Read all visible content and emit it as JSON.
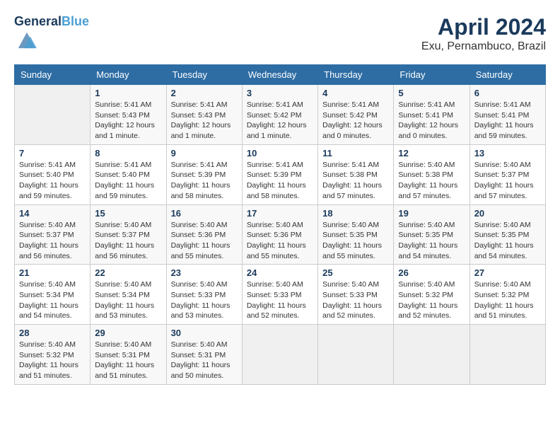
{
  "header": {
    "logo_line1": "General",
    "logo_line2": "Blue",
    "month_title": "April 2024",
    "location": "Exu, Pernambuco, Brazil"
  },
  "weekdays": [
    "Sunday",
    "Monday",
    "Tuesday",
    "Wednesday",
    "Thursday",
    "Friday",
    "Saturday"
  ],
  "weeks": [
    [
      {
        "day": "",
        "sunrise": "",
        "sunset": "",
        "daylight": ""
      },
      {
        "day": "1",
        "sunrise": "Sunrise: 5:41 AM",
        "sunset": "Sunset: 5:43 PM",
        "daylight": "Daylight: 12 hours and 1 minute."
      },
      {
        "day": "2",
        "sunrise": "Sunrise: 5:41 AM",
        "sunset": "Sunset: 5:43 PM",
        "daylight": "Daylight: 12 hours and 1 minute."
      },
      {
        "day": "3",
        "sunrise": "Sunrise: 5:41 AM",
        "sunset": "Sunset: 5:42 PM",
        "daylight": "Daylight: 12 hours and 1 minute."
      },
      {
        "day": "4",
        "sunrise": "Sunrise: 5:41 AM",
        "sunset": "Sunset: 5:42 PM",
        "daylight": "Daylight: 12 hours and 0 minutes."
      },
      {
        "day": "5",
        "sunrise": "Sunrise: 5:41 AM",
        "sunset": "Sunset: 5:41 PM",
        "daylight": "Daylight: 12 hours and 0 minutes."
      },
      {
        "day": "6",
        "sunrise": "Sunrise: 5:41 AM",
        "sunset": "Sunset: 5:41 PM",
        "daylight": "Daylight: 11 hours and 59 minutes."
      }
    ],
    [
      {
        "day": "7",
        "sunrise": "Sunrise: 5:41 AM",
        "sunset": "Sunset: 5:40 PM",
        "daylight": "Daylight: 11 hours and 59 minutes."
      },
      {
        "day": "8",
        "sunrise": "Sunrise: 5:41 AM",
        "sunset": "Sunset: 5:40 PM",
        "daylight": "Daylight: 11 hours and 59 minutes."
      },
      {
        "day": "9",
        "sunrise": "Sunrise: 5:41 AM",
        "sunset": "Sunset: 5:39 PM",
        "daylight": "Daylight: 11 hours and 58 minutes."
      },
      {
        "day": "10",
        "sunrise": "Sunrise: 5:41 AM",
        "sunset": "Sunset: 5:39 PM",
        "daylight": "Daylight: 11 hours and 58 minutes."
      },
      {
        "day": "11",
        "sunrise": "Sunrise: 5:41 AM",
        "sunset": "Sunset: 5:38 PM",
        "daylight": "Daylight: 11 hours and 57 minutes."
      },
      {
        "day": "12",
        "sunrise": "Sunrise: 5:40 AM",
        "sunset": "Sunset: 5:38 PM",
        "daylight": "Daylight: 11 hours and 57 minutes."
      },
      {
        "day": "13",
        "sunrise": "Sunrise: 5:40 AM",
        "sunset": "Sunset: 5:37 PM",
        "daylight": "Daylight: 11 hours and 57 minutes."
      }
    ],
    [
      {
        "day": "14",
        "sunrise": "Sunrise: 5:40 AM",
        "sunset": "Sunset: 5:37 PM",
        "daylight": "Daylight: 11 hours and 56 minutes."
      },
      {
        "day": "15",
        "sunrise": "Sunrise: 5:40 AM",
        "sunset": "Sunset: 5:37 PM",
        "daylight": "Daylight: 11 hours and 56 minutes."
      },
      {
        "day": "16",
        "sunrise": "Sunrise: 5:40 AM",
        "sunset": "Sunset: 5:36 PM",
        "daylight": "Daylight: 11 hours and 55 minutes."
      },
      {
        "day": "17",
        "sunrise": "Sunrise: 5:40 AM",
        "sunset": "Sunset: 5:36 PM",
        "daylight": "Daylight: 11 hours and 55 minutes."
      },
      {
        "day": "18",
        "sunrise": "Sunrise: 5:40 AM",
        "sunset": "Sunset: 5:35 PM",
        "daylight": "Daylight: 11 hours and 55 minutes."
      },
      {
        "day": "19",
        "sunrise": "Sunrise: 5:40 AM",
        "sunset": "Sunset: 5:35 PM",
        "daylight": "Daylight: 11 hours and 54 minutes."
      },
      {
        "day": "20",
        "sunrise": "Sunrise: 5:40 AM",
        "sunset": "Sunset: 5:35 PM",
        "daylight": "Daylight: 11 hours and 54 minutes."
      }
    ],
    [
      {
        "day": "21",
        "sunrise": "Sunrise: 5:40 AM",
        "sunset": "Sunset: 5:34 PM",
        "daylight": "Daylight: 11 hours and 54 minutes."
      },
      {
        "day": "22",
        "sunrise": "Sunrise: 5:40 AM",
        "sunset": "Sunset: 5:34 PM",
        "daylight": "Daylight: 11 hours and 53 minutes."
      },
      {
        "day": "23",
        "sunrise": "Sunrise: 5:40 AM",
        "sunset": "Sunset: 5:33 PM",
        "daylight": "Daylight: 11 hours and 53 minutes."
      },
      {
        "day": "24",
        "sunrise": "Sunrise: 5:40 AM",
        "sunset": "Sunset: 5:33 PM",
        "daylight": "Daylight: 11 hours and 52 minutes."
      },
      {
        "day": "25",
        "sunrise": "Sunrise: 5:40 AM",
        "sunset": "Sunset: 5:33 PM",
        "daylight": "Daylight: 11 hours and 52 minutes."
      },
      {
        "day": "26",
        "sunrise": "Sunrise: 5:40 AM",
        "sunset": "Sunset: 5:32 PM",
        "daylight": "Daylight: 11 hours and 52 minutes."
      },
      {
        "day": "27",
        "sunrise": "Sunrise: 5:40 AM",
        "sunset": "Sunset: 5:32 PM",
        "daylight": "Daylight: 11 hours and 51 minutes."
      }
    ],
    [
      {
        "day": "28",
        "sunrise": "Sunrise: 5:40 AM",
        "sunset": "Sunset: 5:32 PM",
        "daylight": "Daylight: 11 hours and 51 minutes."
      },
      {
        "day": "29",
        "sunrise": "Sunrise: 5:40 AM",
        "sunset": "Sunset: 5:31 PM",
        "daylight": "Daylight: 11 hours and 51 minutes."
      },
      {
        "day": "30",
        "sunrise": "Sunrise: 5:40 AM",
        "sunset": "Sunset: 5:31 PM",
        "daylight": "Daylight: 11 hours and 50 minutes."
      },
      {
        "day": "",
        "sunrise": "",
        "sunset": "",
        "daylight": ""
      },
      {
        "day": "",
        "sunrise": "",
        "sunset": "",
        "daylight": ""
      },
      {
        "day": "",
        "sunrise": "",
        "sunset": "",
        "daylight": ""
      },
      {
        "day": "",
        "sunrise": "",
        "sunset": "",
        "daylight": ""
      }
    ]
  ]
}
